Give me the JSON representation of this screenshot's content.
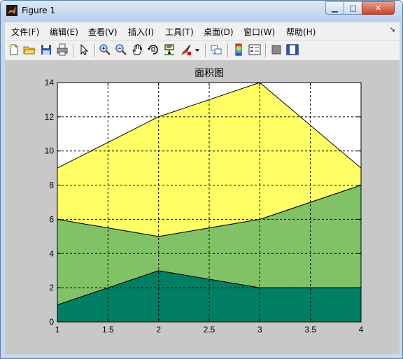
{
  "window": {
    "title": "Figure 1",
    "buttons": {
      "minimize": "▁",
      "maximize": "□",
      "close": "✕"
    }
  },
  "menu": {
    "items": [
      "文件(F)",
      "编辑(E)",
      "查看(V)",
      "插入(I)",
      "工具(T)",
      "桌面(D)",
      "窗口(W)",
      "帮助(H)"
    ],
    "expand": "↘"
  },
  "toolbar": {
    "icons": [
      "new-figure-icon",
      "open-file-icon",
      "save-icon",
      "print-icon",
      "pointer-icon",
      "zoom-in-icon",
      "zoom-out-icon",
      "pan-hand-icon",
      "rotate-3d-icon",
      "data-cursor-icon",
      "brush-icon",
      "brush-dropdown-icon",
      "link-plot-icon",
      "colorbar-icon",
      "legend-icon",
      "hide-plot-tools-icon",
      "show-plot-tools-icon"
    ]
  },
  "chart_data": {
    "type": "area",
    "title": "面积图",
    "xlabel": "",
    "ylabel": "",
    "x": [
      1,
      2,
      3,
      4
    ],
    "series": [
      {
        "values": [
          1,
          3,
          2,
          2
        ],
        "color": "#007f62"
      },
      {
        "values": [
          5,
          2,
          4,
          6
        ],
        "color": "#82c266"
      },
      {
        "values": [
          3,
          7,
          8,
          1
        ],
        "color": "#ffff66"
      }
    ],
    "xlim": [
      1,
      4
    ],
    "ylim": [
      0,
      14
    ],
    "xticks": [
      1,
      1.5,
      2,
      2.5,
      3,
      3.5,
      4
    ],
    "xticklabels": [
      "1",
      "1.5",
      "2",
      "2.5",
      "3",
      "3.5",
      "4"
    ],
    "yticks": [
      0,
      2,
      4,
      6,
      8,
      10,
      12,
      14
    ],
    "yticklabels": [
      "0",
      "2",
      "4",
      "6",
      "8",
      "10",
      "12",
      "14"
    ],
    "grid": true,
    "grid_style": "dashed",
    "stacked": true
  }
}
